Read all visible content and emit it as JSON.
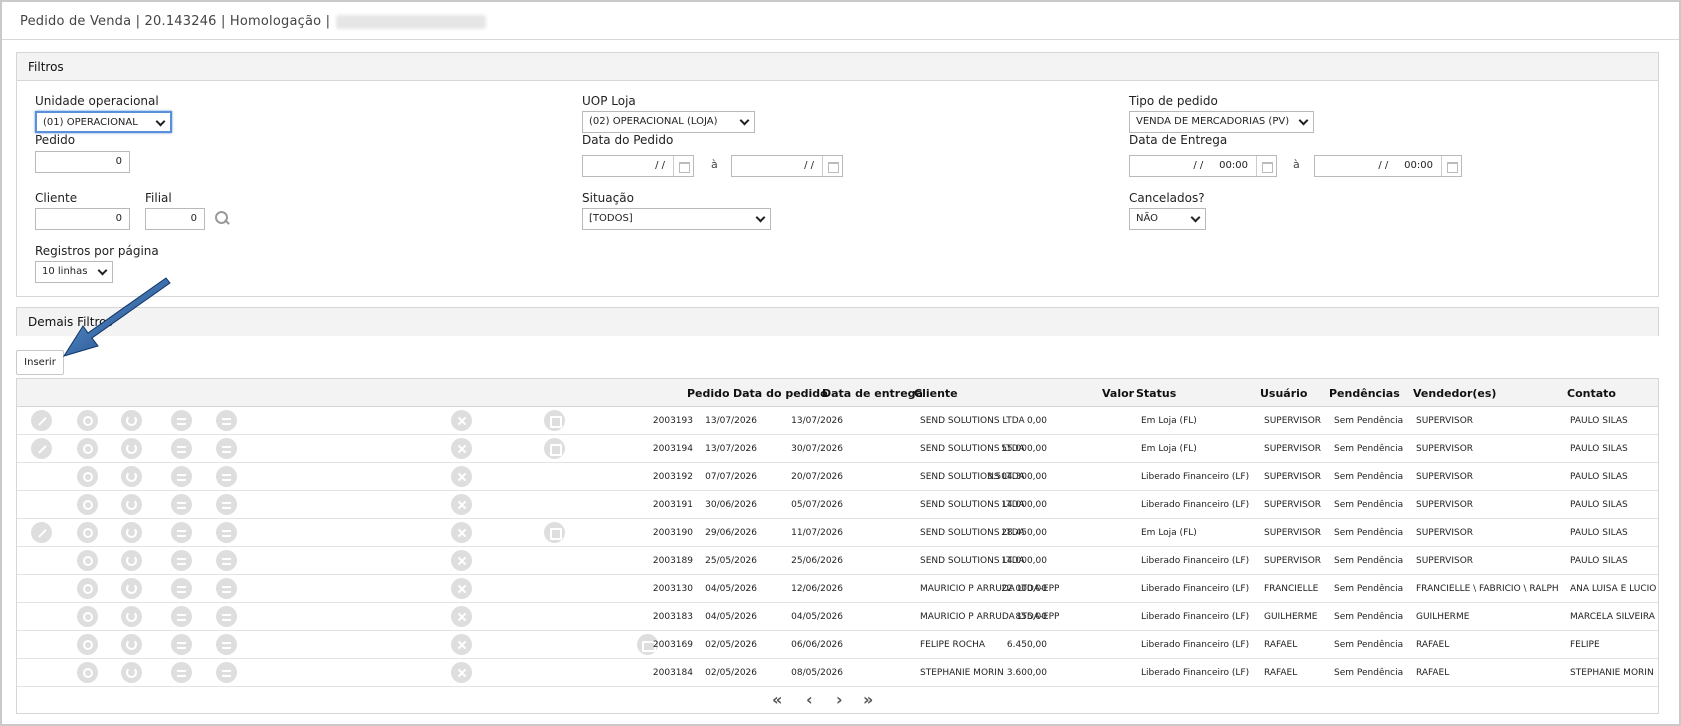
{
  "header": {
    "title": "Pedido de Venda | 20.143246 | Homologação |"
  },
  "filtros": {
    "title": "Filtros",
    "unidade_label": "Unidade operacional",
    "unidade_value": "(01) OPERACIONAL",
    "uop_label": "UOP Loja",
    "uop_value": "(02) OPERACIONAL (LOJA)",
    "tipo_label": "Tipo de pedido",
    "tipo_value": "VENDA DE MERCADORIAS (PV)",
    "pedido_label": "Pedido",
    "pedido_value": "0",
    "data_pedido_label": "Data do Pedido",
    "data_pedido_from": "/ /",
    "data_pedido_to": "/ /",
    "a_label": "à",
    "data_entrega_label": "Data de Entrega",
    "data_entrega_from": "/ /     00:00",
    "data_entrega_to": "/ /     00:00",
    "cliente_label": "Cliente",
    "cliente_value": "0",
    "filial_label": "Filial",
    "filial_value": "0",
    "situacao_label": "Situação",
    "situacao_value": "[TODOS]",
    "cancelados_label": "Cancelados?",
    "cancelados_value": "NÃO",
    "registros_label": "Registros por página",
    "registros_value": "10 linhas"
  },
  "demais": {
    "title": "Demais Filtros"
  },
  "toolbar": {
    "inserir_label": "Inserir"
  },
  "grid": {
    "headers": {
      "pedido": "Pedido",
      "data_pedido": "Data do pedido",
      "data_entrega": "Data de entrega",
      "cliente": "Cliente",
      "valor": "Valor",
      "status": "Status",
      "usuario": "Usuário",
      "pendencias": "Pendências",
      "vendedor": "Vendedor(es)",
      "contato": "Contato"
    },
    "rows": [
      {
        "pedido": "2003193",
        "data_pedido": "13/07/2026",
        "data_entrega": "13/07/2026",
        "cliente": "SEND SOLUTIONS LTDA",
        "valor": "0,00",
        "status": "Em Loja (FL)",
        "usuario": "SUPERVISOR",
        "pendencias": "Sem Pendência",
        "vendedor": "SUPERVISOR",
        "contato": "PAULO SILAS"
      },
      {
        "pedido": "2003194",
        "data_pedido": "13/07/2026",
        "data_entrega": "30/07/2026",
        "cliente": "SEND SOLUTIONS LTDA",
        "valor": "55.000,00",
        "status": "Em Loja (FL)",
        "usuario": "SUPERVISOR",
        "pendencias": "Sem Pendência",
        "vendedor": "SUPERVISOR",
        "contato": "PAULO SILAS"
      },
      {
        "pedido": "2003192",
        "data_pedido": "07/07/2026",
        "data_entrega": "20/07/2026",
        "cliente": "SEND SOLUTIONS LTDA",
        "valor": "3.504.300,00",
        "status": "Liberado Financeiro (LF)",
        "usuario": "SUPERVISOR",
        "pendencias": "Sem Pendência",
        "vendedor": "SUPERVISOR",
        "contato": "PAULO SILAS"
      },
      {
        "pedido": "2003191",
        "data_pedido": "30/06/2026",
        "data_entrega": "05/07/2026",
        "cliente": "SEND SOLUTIONS LTDA",
        "valor": "14.000,00",
        "status": "Liberado Financeiro (LF)",
        "usuario": "SUPERVISOR",
        "pendencias": "Sem Pendência",
        "vendedor": "SUPERVISOR",
        "contato": "PAULO SILAS"
      },
      {
        "pedido": "2003190",
        "data_pedido": "29/06/2026",
        "data_entrega": "11/07/2026",
        "cliente": "SEND SOLUTIONS LTDA",
        "valor": "28.450,00",
        "status": "Em Loja (FL)",
        "usuario": "SUPERVISOR",
        "pendencias": "Sem Pendência",
        "vendedor": "SUPERVISOR",
        "contato": "PAULO SILAS"
      },
      {
        "pedido": "2003189",
        "data_pedido": "25/05/2026",
        "data_entrega": "25/06/2026",
        "cliente": "SEND SOLUTIONS LTDA",
        "valor": "14.000,00",
        "status": "Liberado Financeiro (LF)",
        "usuario": "SUPERVISOR",
        "pendencias": "Sem Pendência",
        "vendedor": "SUPERVISOR",
        "contato": "PAULO SILAS"
      },
      {
        "pedido": "2003130",
        "data_pedido": "04/05/2026",
        "data_entrega": "12/06/2026",
        "cliente": "MAURICIO P ARRUDA LTDA-EPP",
        "valor": "22.000,00",
        "status": "Liberado Financeiro (LF)",
        "usuario": "FRANCIELLE",
        "pendencias": "Sem Pendência",
        "vendedor": "FRANCIELLE \\ FABRICIO \\ RALPH",
        "contato": "ANA LUISA E LUCIO"
      },
      {
        "pedido": "2003183",
        "data_pedido": "04/05/2026",
        "data_entrega": "04/05/2026",
        "cliente": "MAURICIO P ARRUDA LTDA-EPP",
        "valor": "855,00",
        "status": "Liberado Financeiro (LF)",
        "usuario": "GUILHERME",
        "pendencias": "Sem Pendência",
        "vendedor": "GUILHERME",
        "contato": "MARCELA SILVEIRA"
      },
      {
        "pedido": "2003169",
        "data_pedido": "02/05/2026",
        "data_entrega": "06/06/2026",
        "cliente": "FELIPE ROCHA",
        "valor": "6.450,00",
        "status": "Liberado Financeiro (LF)",
        "usuario": "RAFAEL",
        "pendencias": "Sem Pendência",
        "vendedor": "RAFAEL",
        "contato": "FELIPE"
      },
      {
        "pedido": "2003184",
        "data_pedido": "02/05/2026",
        "data_entrega": "08/05/2026",
        "cliente": "STEPHANIE MORIN",
        "valor": "3.600,00",
        "status": "Liberado Financeiro (LF)",
        "usuario": "RAFAEL",
        "pendencias": "Sem Pendência",
        "vendedor": "RAFAEL",
        "contato": "STEPHANIE MORIN"
      }
    ]
  },
  "pager": {
    "first": "«",
    "prev": "‹",
    "next": "›",
    "last": "»"
  },
  "colors": {
    "accent_arrow": "#1f5fa8",
    "focus": "#5a8fd9",
    "icon_gray": "#dedede"
  }
}
